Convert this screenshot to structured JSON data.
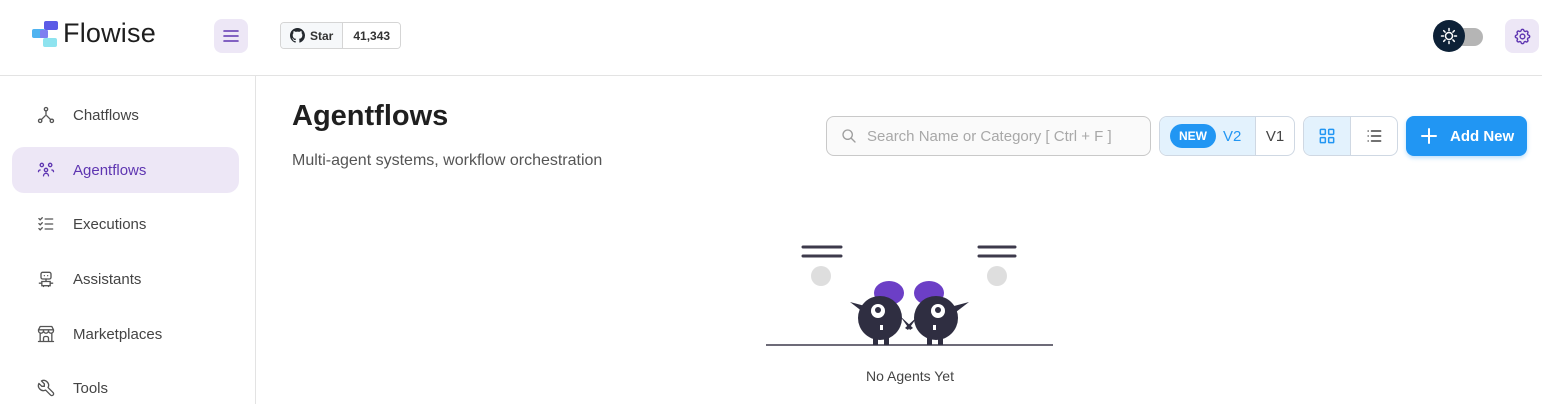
{
  "header": {
    "logo_text": "Flowise",
    "github": {
      "star_label": "Star",
      "star_count": "41,343"
    }
  },
  "sidebar": {
    "items": [
      {
        "label": "Chatflows",
        "icon": "hierarchy-icon",
        "active": false
      },
      {
        "label": "Agentflows",
        "icon": "users-group-icon",
        "active": true
      },
      {
        "label": "Executions",
        "icon": "list-check-icon",
        "active": false
      },
      {
        "label": "Assistants",
        "icon": "robot-icon",
        "active": false
      },
      {
        "label": "Marketplaces",
        "icon": "building-store-icon",
        "active": false
      },
      {
        "label": "Tools",
        "icon": "tool-icon",
        "active": false
      }
    ]
  },
  "main": {
    "title": "Agentflows",
    "subtitle": "Multi-agent systems, workflow orchestration",
    "search": {
      "placeholder": "Search Name or Category [ Ctrl + F ]",
      "value": ""
    },
    "version_toggle": {
      "badge": "NEW",
      "v2": "V2",
      "v1": "V1",
      "selected": "V2"
    },
    "view_mode": "card",
    "add_button": "Add New",
    "empty_state": "No Agents Yet"
  },
  "colors": {
    "accent_purple": "#5e35b1",
    "accent_purple_light": "#ede7f6",
    "primary_blue": "#2196f3",
    "primary_blue_light": "#e3f2fd",
    "dark_navy": "#0d2137"
  }
}
